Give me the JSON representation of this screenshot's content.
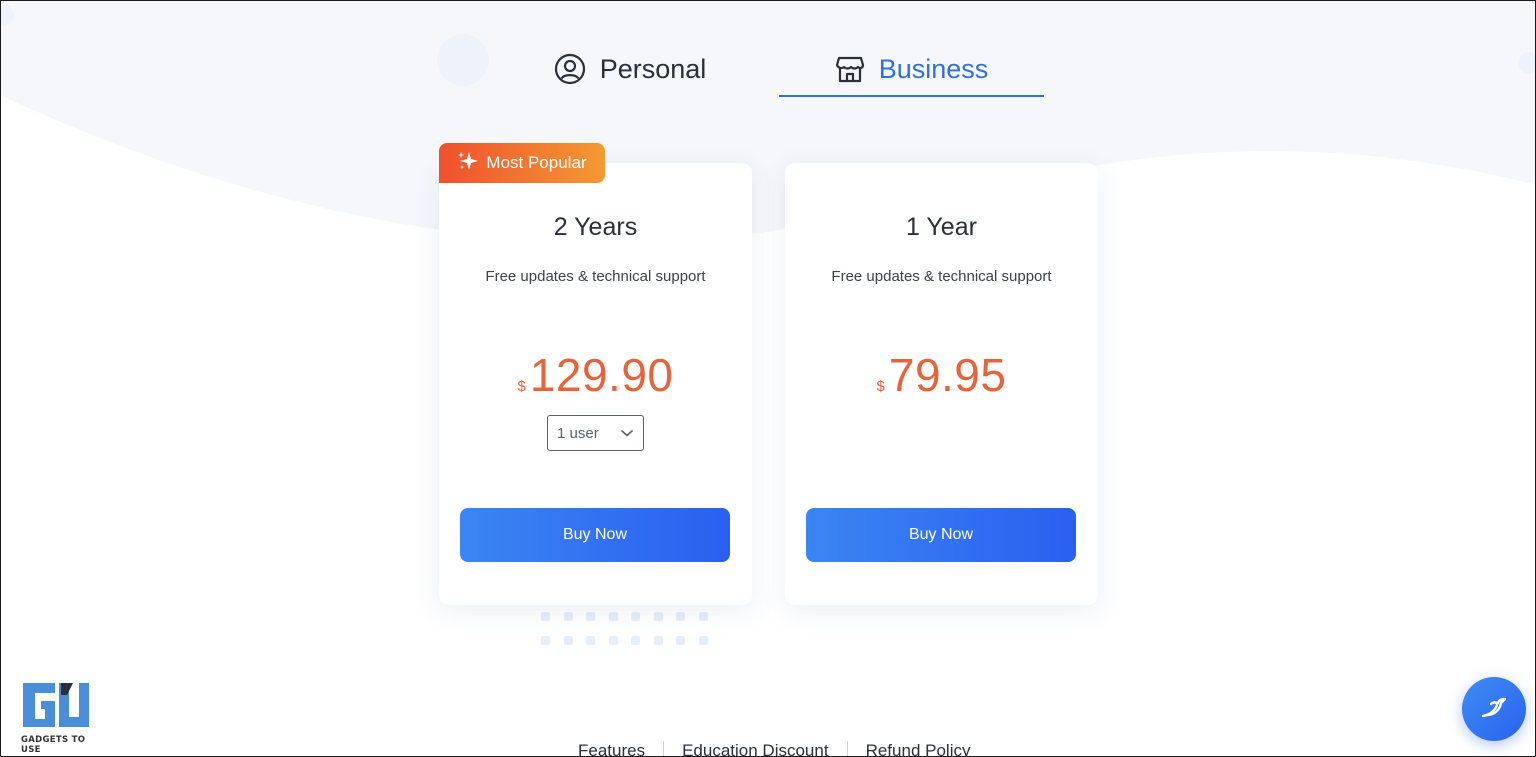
{
  "tabs": {
    "personal": {
      "label": "Personal",
      "icon": "user-circle-icon"
    },
    "business": {
      "label": "Business",
      "icon": "store-icon",
      "active": true
    }
  },
  "badge": {
    "label": "Most Popular",
    "icon": "sparkle-icon"
  },
  "plans": [
    {
      "title": "2 Years",
      "subtitle": "Free updates & technical support",
      "currency": "$",
      "price": "129.90",
      "user_select": {
        "selected": "1 user"
      },
      "button": "Buy Now"
    },
    {
      "title": "1 Year",
      "subtitle": "Free updates & technical support",
      "currency": "$",
      "price": "79.95",
      "button": "Buy Now"
    }
  ],
  "footer": {
    "links": [
      "Features",
      "Education Discount",
      "Refund Policy"
    ]
  },
  "logo": {
    "text": "GADGETS TO USE"
  },
  "colors": {
    "accent": "#2f6fe0",
    "price": "#e8623a",
    "badge_start": "#f0502e",
    "badge_end": "#f39a32",
    "button_start": "#3b86f3",
    "button_end": "#2a5ff0"
  },
  "chat": {
    "icon": "chat-bird-icon"
  }
}
